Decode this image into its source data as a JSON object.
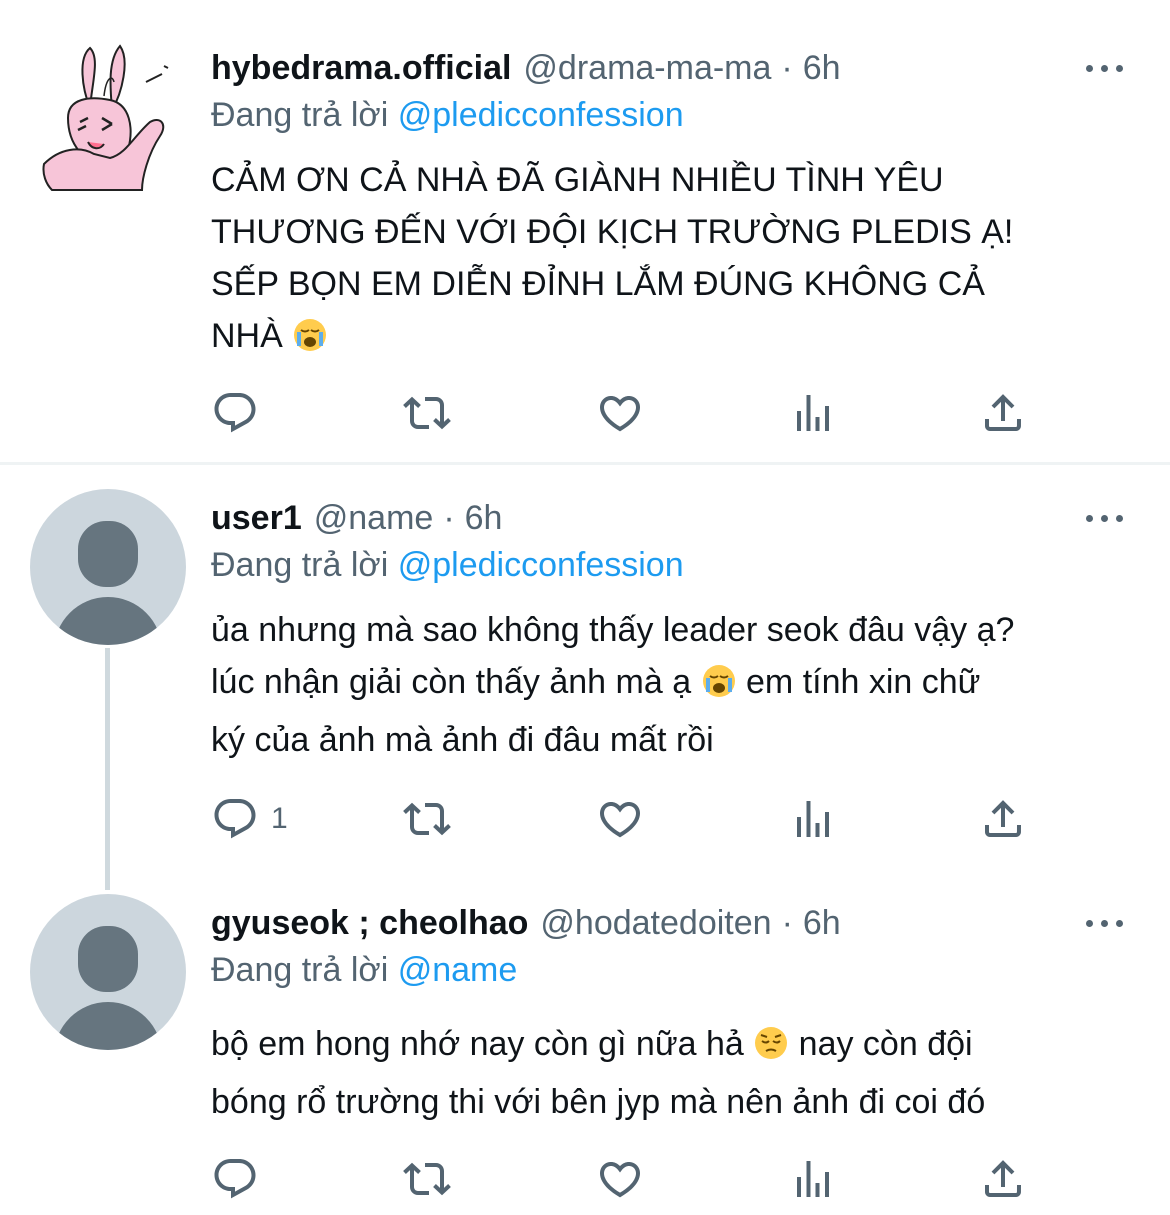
{
  "tweets": [
    {
      "display_name": "hybedrama.official",
      "handle": "@drama-ma-ma",
      "separator": "·",
      "time": "6h",
      "reply_prefix": "Đang trả lời",
      "reply_to": "@pledicconfession",
      "lines": [
        "CẢM ƠN CẢ NHÀ ĐÃ GIÀNH NHIỀU TÌNH YÊU",
        "THƯƠNG ĐẾN VỚI ĐỘI KỊCH TRƯỜNG PLEDIS Ạ!",
        "SẾP BỌN EM DIỄN ĐỈNH LẮM ĐÚNG KHÔNG CẢ",
        "NHÀ"
      ],
      "reply_count": "",
      "avatar": "bunny-cartoon-avatar"
    },
    {
      "display_name": "user1",
      "handle": "@name",
      "separator": "·",
      "time": "6h",
      "reply_prefix": "Đang trả lời",
      "reply_to": "@pledicconfession",
      "lines": [
        "ủa nhưng mà sao không thấy leader seok đâu vậy ạ?",
        "lúc nhận giải còn thấy ảnh mà ạ",
        "em tính xin chữ",
        "ký của ảnh mà ảnh đi đâu mất rồi"
      ],
      "reply_count": "1",
      "avatar": "default-profile-avatar"
    },
    {
      "display_name": "gyuseok ; cheolhao",
      "handle": "@hodatedoiten",
      "separator": "·",
      "time": "6h",
      "reply_prefix": "Đang trả lời",
      "reply_to": "@name",
      "lines": [
        "bộ em hong nhớ nay còn gì nữa hả",
        "nay còn đội",
        "bóng rổ trường thi với bên jyp mà nên ảnh đi coi đó"
      ],
      "reply_count": "",
      "avatar": "default-profile-avatar"
    }
  ],
  "emojis": [
    "loudly-crying-face",
    "loudly-crying-face",
    "pensive-face"
  ],
  "icons": [
    "reply-icon",
    "retweet-icon",
    "like-icon",
    "analytics-icon",
    "share-icon",
    "more-icon"
  ],
  "colors": {
    "text": "#0f1419",
    "secondary": "#536471",
    "link": "#1d9bf0",
    "divider": "#eff3f4",
    "thread_line": "#cfd9de",
    "avatar_bg": "#ccd6dd",
    "bunny": "#f7c5d8"
  }
}
